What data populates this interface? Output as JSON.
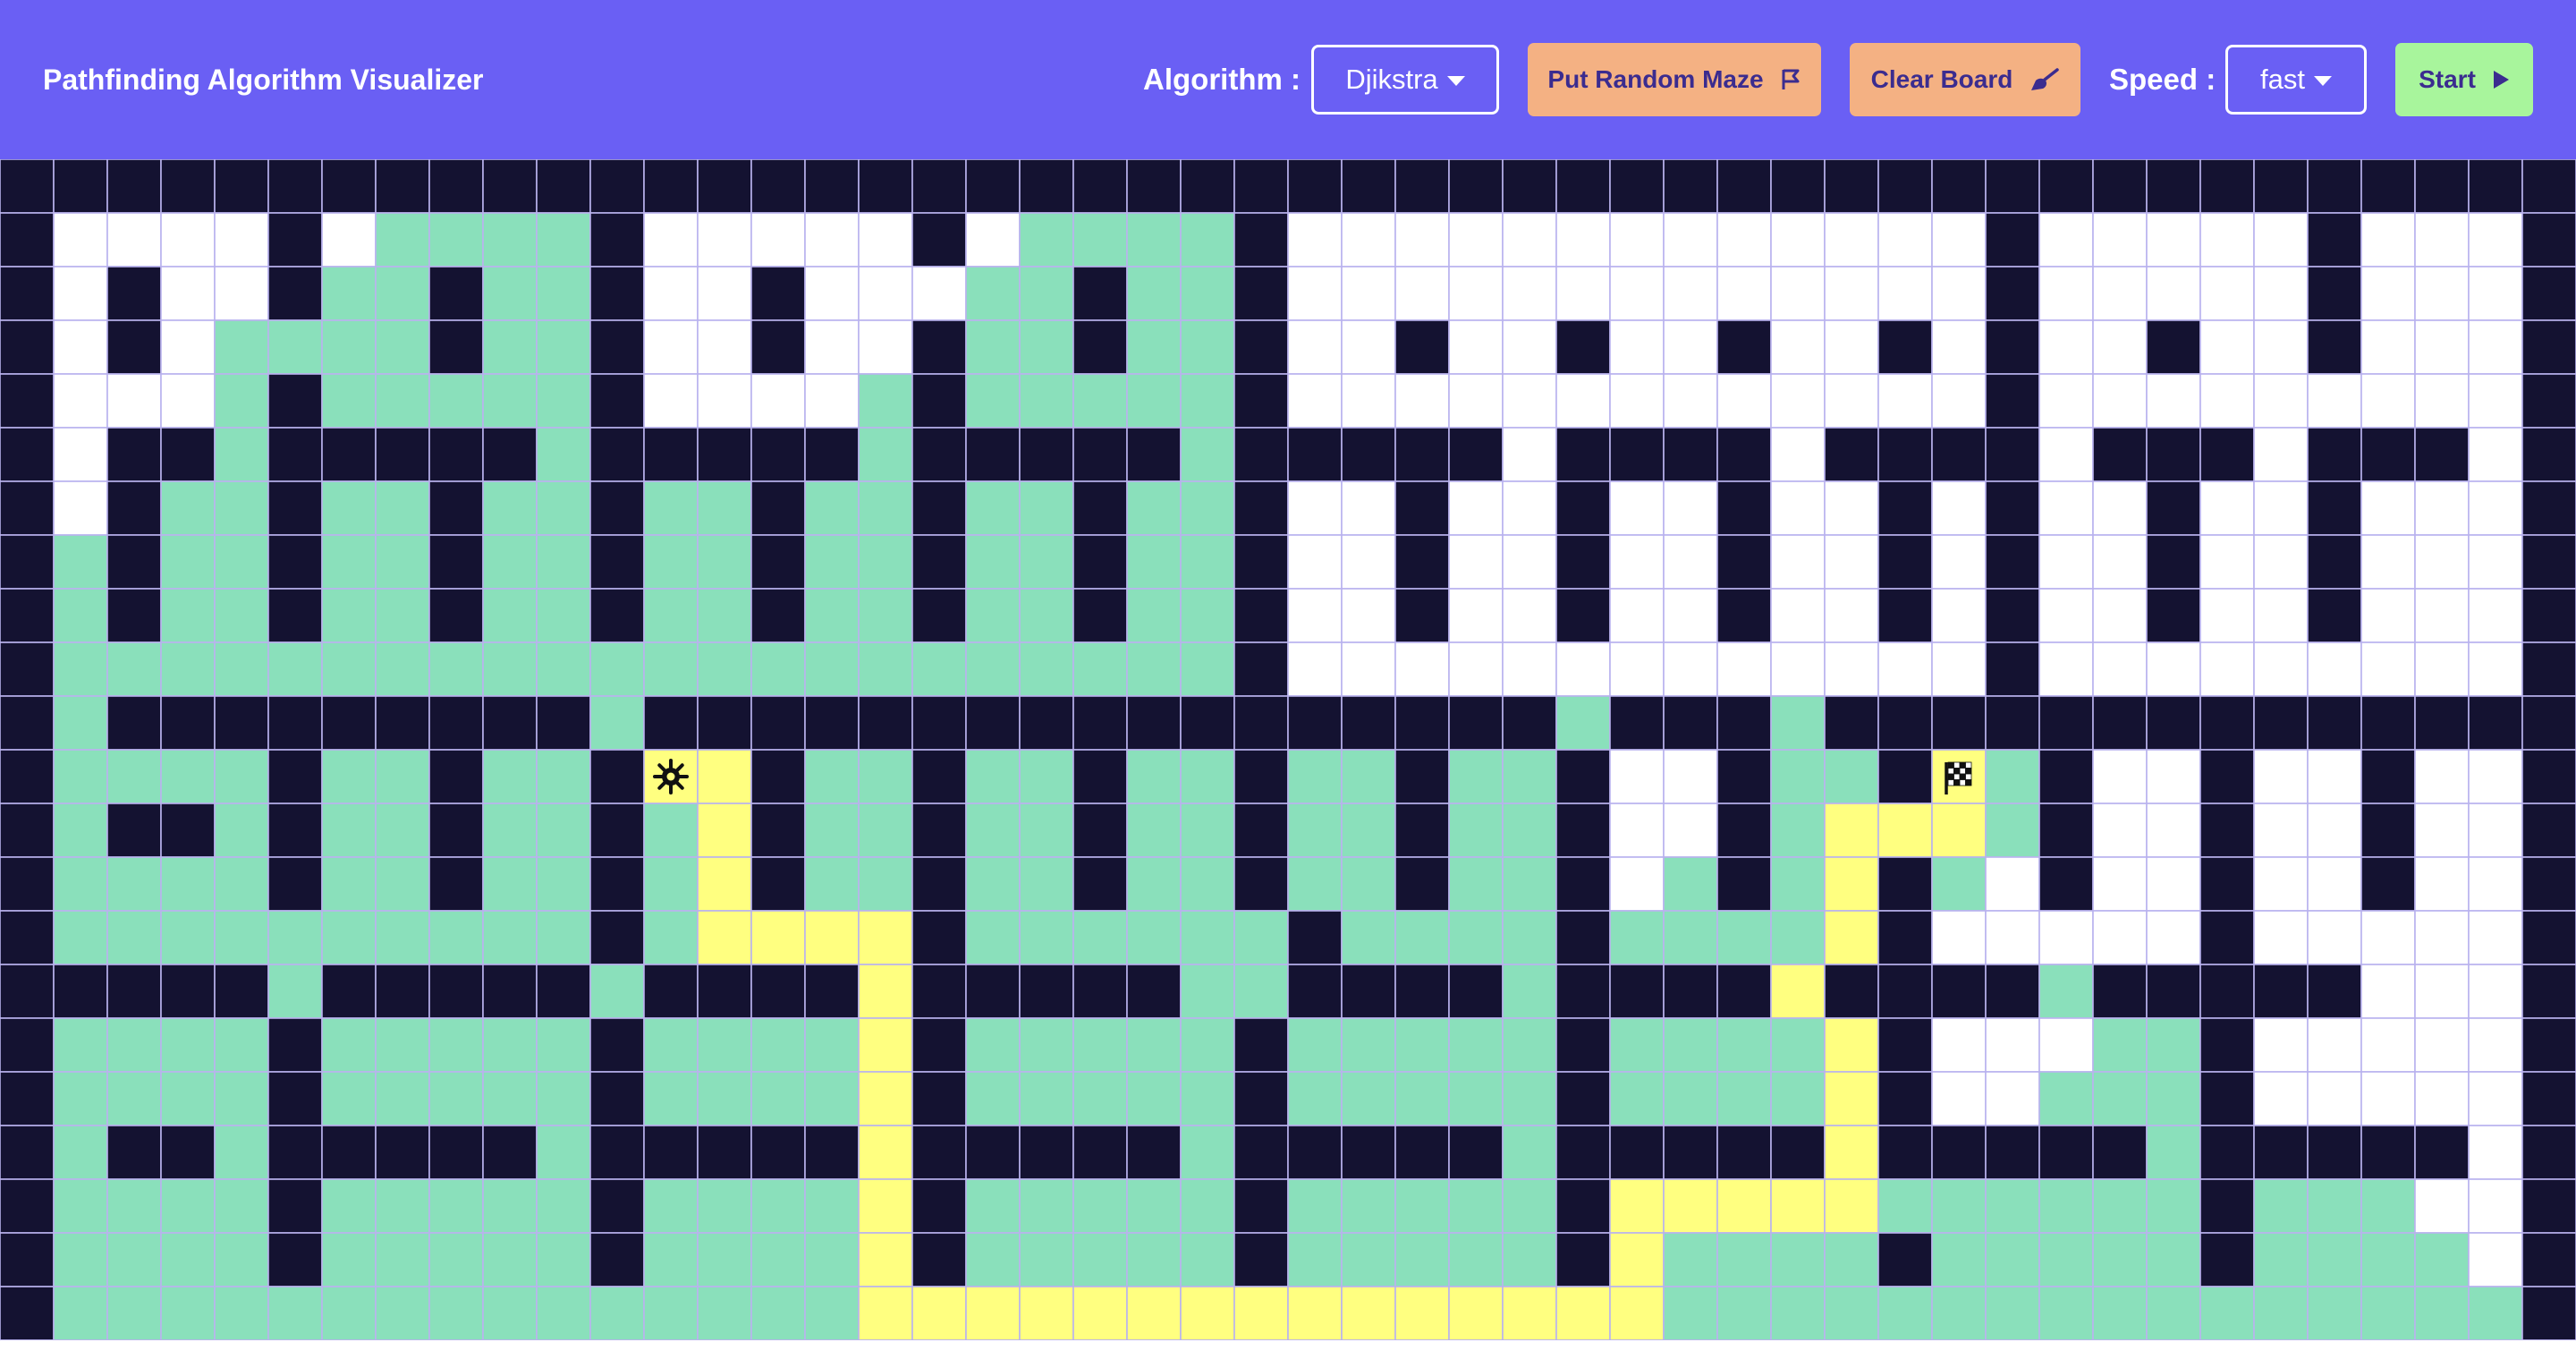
{
  "navbar": {
    "title": "Pathfinding Algorithm Visualizer",
    "algorithm_label": "Algorithm :",
    "algorithm_value": "Djikstra",
    "maze_button": "Put Random Maze",
    "maze_icon": "flag-outline-icon",
    "clear_button": "Clear Board",
    "clear_icon": "broom-icon",
    "speed_label": "Speed :",
    "speed_value": "fast",
    "start_button": "Start",
    "start_icon": "play-icon"
  },
  "colors": {
    "navbar": "#6a5ff4",
    "wall": "#141231",
    "unvisited": "#ffffff",
    "visited": "#8ae0bb",
    "path": "#ffff80",
    "grid_line": "#b9b2ee",
    "maze_button": "#f4b183",
    "start_button": "#a8f59c"
  },
  "grid": {
    "rows": 22,
    "cols": 48,
    "legend": {
      "#": "wall",
      ".": "unvisited",
      "v": "visited",
      "p": "path",
      "S": "start-node",
      "T": "target-node"
    },
    "start": {
      "row": 11,
      "col": 12,
      "icon": "sun-gear-icon"
    },
    "target": {
      "row": 11,
      "col": 36,
      "icon": "checkered-flag-icon"
    },
    "cells": [
      "################################################",
      "#....#.vvvv#.....#.vvvv#.............#.....#...#",
      "#.#..#vv#vv#..#...vv#vv#.............#.....#...#",
      "#.#.vvvv#vv#..#..#vv#vv#..#..#..#..#.#..#..#...#",
      "#...v#vvvvv#....v#vvvvv#.............#.........#",
      "#.##v#####v#####v#####v#####.####.####.###.###.#",
      "#.#vv#vv#vv#vv#vv#vv#vv#..#..#..#..#.#..#..#...#",
      "#v#vv#vv#vv#vv#vv#vv#vv#..#..#..#..#.#..#..#...#",
      "#v#vv#vv#vv#vv#vv#vv#vv#..#..#..#..#.#..#..#...#",
      "#vvvvvvvvvvvvvvvvvvvvvv#.............#.........#",
      "#v#########v#################v###v##############",
      "#vvvv#vv#vv#Sp#vv#vv#vv#vv#vv#..#vv#Tv#..#..#..#",
      "#v##v#vv#vv#vp#vv#vv#vv#vv#vv#..#vpppv#..#..#..#",
      "#vvvv#vv#vv#vp#vv#vv#vv#vv#vv#.v#vp#v.#..#..#..#",
      "#vvvvvvvvvv#vpppp#vvvvvv#vvvv#vvvvp#.....#.....#",
      "#####v#####v####p#####vv####v####p####v#####...#",
      "#vvvv#vvvvv#vvvvp#vvvvv#vvvvv#vvvvp#...vv#.....#",
      "#vvvv#vvvvv#vvvvp#vvvvv#vvvvv#vvvvp#..vvv#.....#",
      "#v##v#####v#####p#####v#####v#####p#####v#####.#",
      "#vvvv#vvvvv#vvvvp#vvvvv#vvvvv#pppppvvvvvv#vvv..#",
      "#vvvv#vvvvv#vvvvp#vvvvv#vvvvv#pvvvv#vvvvv#vvvv.#",
      "#vvvvvvvvvvvvvvvpppppppppppppppvvvvvvvvvvvvvvvv#",
      "################################################"
    ]
  }
}
